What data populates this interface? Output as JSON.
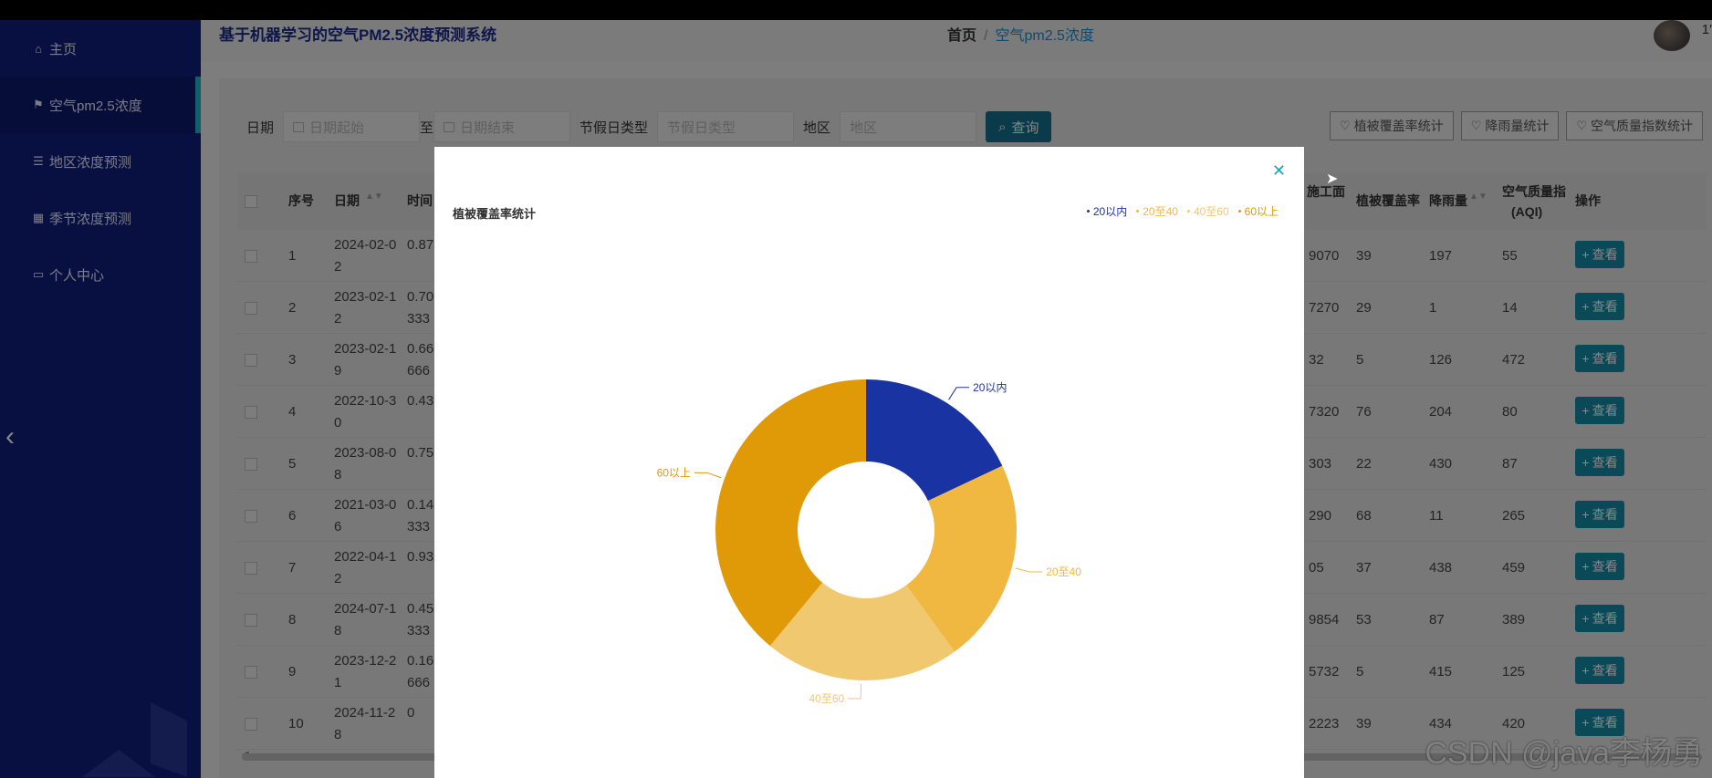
{
  "app": {
    "title": "基于机器学习的空气PM2.5浓度预测系统",
    "avatar_text": "1'"
  },
  "breadcrumb": {
    "home": "首页",
    "separator": "/",
    "current": "空气pm2.5浓度"
  },
  "sidebar": {
    "items": [
      {
        "label": "主页",
        "icon": "home-icon"
      },
      {
        "label": "空气pm2.5浓度",
        "icon": "flag-icon"
      },
      {
        "label": "地区浓度预测",
        "icon": "list-icon"
      },
      {
        "label": "季节浓度预测",
        "icon": "grid-icon"
      },
      {
        "label": "个人中心",
        "icon": "user-card-icon"
      }
    ]
  },
  "filter": {
    "date_label": "日期",
    "date_start_placeholder": "日期起始",
    "date_to": "至",
    "date_end_placeholder": "日期结束",
    "holiday_label": "节假日类型",
    "holiday_placeholder": "节假日类型",
    "region_label": "地区",
    "region_placeholder": "地区",
    "search_label": "查询"
  },
  "stat_buttons": [
    "植被覆盖率统计",
    "降雨量统计",
    "空气质量指数统计"
  ],
  "table": {
    "headers": {
      "index": "序号",
      "date": "日期",
      "time": "时间",
      "construction": "施工面",
      "vegetation": "植被覆盖率",
      "rainfall": "降雨量",
      "aqi_line1": "空气质量指",
      "aqi_line2": "(AQI)",
      "action": "操作"
    },
    "view_label": "查看",
    "rows": [
      {
        "index": "1",
        "date1": "2024-02-0",
        "date2": "2",
        "time1": "0.87",
        "time2": "",
        "construction": "9070",
        "vegetation": "39",
        "rainfall": "197",
        "aqi": "55"
      },
      {
        "index": "2",
        "date1": "2023-02-1",
        "date2": "2",
        "time1": "0.70",
        "time2": "333",
        "construction": "7270",
        "vegetation": "29",
        "rainfall": "1",
        "aqi": "14"
      },
      {
        "index": "3",
        "date1": "2023-02-1",
        "date2": "9",
        "time1": "0.66",
        "time2": "666",
        "construction": "32",
        "vegetation": "5",
        "rainfall": "126",
        "aqi": "472"
      },
      {
        "index": "4",
        "date1": "2022-10-3",
        "date2": "0",
        "time1": "0.43",
        "time2": "",
        "construction": "7320",
        "vegetation": "76",
        "rainfall": "204",
        "aqi": "80"
      },
      {
        "index": "5",
        "date1": "2023-08-0",
        "date2": "8",
        "time1": "0.75",
        "time2": "",
        "construction": "303",
        "vegetation": "22",
        "rainfall": "430",
        "aqi": "87"
      },
      {
        "index": "6",
        "date1": "2021-03-0",
        "date2": "6",
        "time1": "0.14",
        "time2": "333",
        "construction": "290",
        "vegetation": "68",
        "rainfall": "11",
        "aqi": "265"
      },
      {
        "index": "7",
        "date1": "2022-04-1",
        "date2": "2",
        "time1": "0.93",
        "time2": "",
        "construction": "05",
        "vegetation": "37",
        "rainfall": "438",
        "aqi": "459"
      },
      {
        "index": "8",
        "date1": "2024-07-1",
        "date2": "8",
        "time1": "0.45",
        "time2": "333",
        "construction": "9854",
        "vegetation": "53",
        "rainfall": "87",
        "aqi": "389"
      },
      {
        "index": "9",
        "date1": "2023-12-2",
        "date2": "1",
        "time1": "0.16",
        "time2": "666",
        "construction": "5732",
        "vegetation": "5",
        "rainfall": "415",
        "aqi": "125"
      },
      {
        "index": "10",
        "date1": "2024-11-2",
        "date2": "8",
        "time1": "0",
        "time2": "",
        "construction": "2223",
        "vegetation": "39",
        "rainfall": "434",
        "aqi": "420"
      }
    ]
  },
  "watermark": "CSDN @java李杨勇",
  "dialog": {
    "close_icon": "close-icon"
  },
  "chart_data": {
    "type": "pie",
    "title": "植被覆盖率统计",
    "donut": true,
    "legend_position": "top-right",
    "categories": [
      "20以内",
      "20至40",
      "40至60",
      "60以上"
    ],
    "values": [
      18,
      22,
      21,
      39
    ],
    "colors": [
      "#1a33a3",
      "#f0b840",
      "#f0c870",
      "#e09a08"
    ]
  }
}
